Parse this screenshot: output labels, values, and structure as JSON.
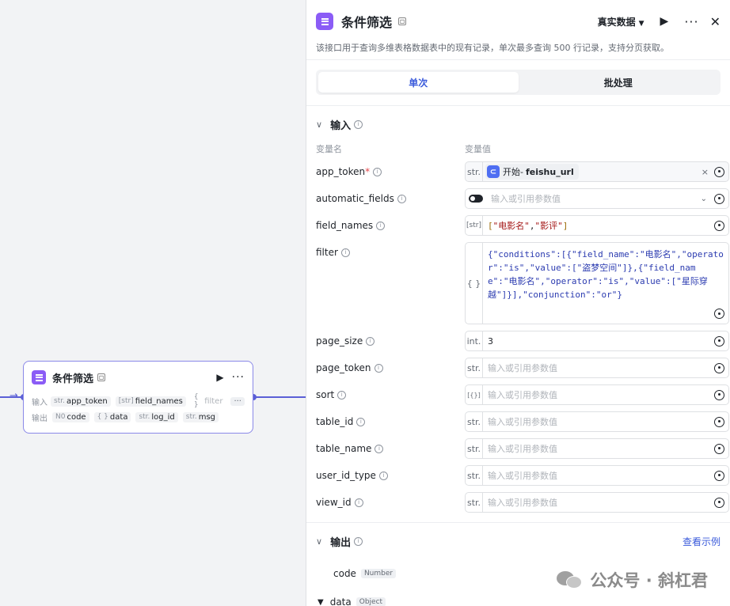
{
  "node": {
    "title": "条件筛选",
    "input_label": "输入",
    "output_label": "输出",
    "inputs": [
      {
        "type": "str.",
        "name": "app_token"
      },
      {
        "type": "[str]",
        "name": "field_names"
      },
      {
        "type": "{ }",
        "name": "filter"
      }
    ],
    "more_inputs": "···",
    "outputs": [
      {
        "type": "N0",
        "name": "code"
      },
      {
        "type": "{ }",
        "name": "data"
      },
      {
        "type": "str.",
        "name": "log_id"
      },
      {
        "type": "str.",
        "name": "msg"
      }
    ]
  },
  "panel": {
    "title": "条件筛选",
    "mode_select": "真实数据",
    "description": "该接口用于查询多维表格数据表中的现有记录，单次最多查询 500 行记录，支持分页获取。",
    "tabs": [
      "单次",
      "批处理"
    ],
    "active_tab": "单次",
    "input_section": {
      "title": "输入",
      "col_name": "变量名",
      "col_value": "变量值",
      "placeholder": "输入或引用参数值",
      "fields": [
        {
          "name": "app_token",
          "required": "*",
          "type": "str.",
          "ref_source": "开始",
          "ref_sep": " - ",
          "ref_field": "feishu_url"
        },
        {
          "name": "automatic_fields",
          "type": "toggle"
        },
        {
          "name": "field_names",
          "type": "[str]",
          "value_prefix": "[",
          "value_items": [
            "\"电影名\"",
            "\"影评\""
          ],
          "value_sep": ",",
          "value_suffix": "]"
        },
        {
          "name": "filter",
          "type": "{ }",
          "value": "{\"conditions\":[{\"field_name\":\"电影名\",\"operator\":\"is\",\"value\":[\"盗梦空间\"]},{\"field_name\":\"电影名\",\"operator\":\"is\",\"value\":[\"星际穿越\"]}],\"conjunction\":\"or\"}"
        },
        {
          "name": "page_size",
          "type": "int.",
          "value": "3"
        },
        {
          "name": "page_token",
          "type": "str."
        },
        {
          "name": "sort",
          "type": "[{}]"
        },
        {
          "name": "table_id",
          "type": "str."
        },
        {
          "name": "table_name",
          "type": "str."
        },
        {
          "name": "user_id_type",
          "type": "str."
        },
        {
          "name": "view_id",
          "type": "str."
        }
      ]
    },
    "output_section": {
      "title": "输出",
      "see_example": "查看示例",
      "items": [
        {
          "name": "code",
          "type": "Number"
        },
        {
          "name": "data",
          "type": "Object"
        }
      ]
    }
  },
  "watermark": {
    "text": "公众号 · 斜杠君"
  },
  "colors": {
    "accent": "#3b5bdb",
    "node_border": "#8a88e8",
    "app_icon": "#8b5cf6",
    "edge": "#5b5fd6"
  }
}
